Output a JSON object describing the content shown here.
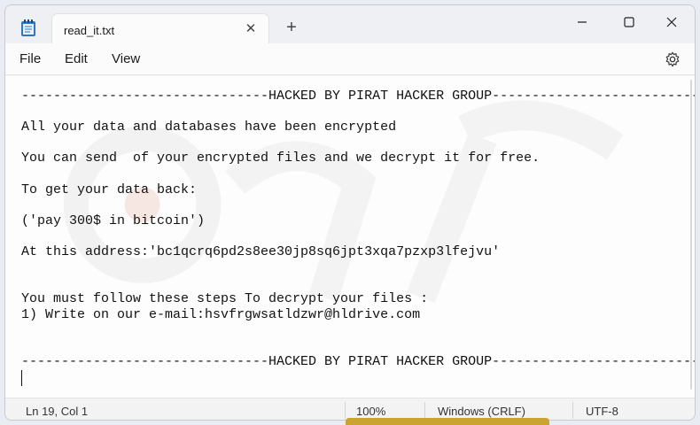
{
  "tab": {
    "title": "read_it.txt",
    "close_glyph": "✕",
    "new_tab_glyph": "+"
  },
  "menu": {
    "file": "File",
    "edit": "Edit",
    "view": "View"
  },
  "document": {
    "lines": [
      "-------------------------------HACKED BY PIRAT HACKER GROUP-------------------------------",
      "All your data and databases have been encrypted",
      "You can send  of your encrypted files and we decrypt it for free.",
      "To get your data back:",
      "('pay 300$ in bitcoin')",
      "At this address:'bc1qcrq6pd2s8ee30jp8sq6jpt3xqa7pzxp3lfejvu'",
      "You must follow these steps To decrypt your files :",
      "1) Write on our e-mail:hsvfrgwsatldzwr@hldrive.com",
      "-------------------------------HACKED BY PIRAT HACKER GROUP-------------------------------"
    ]
  },
  "status": {
    "position": "Ln 19, Col 1",
    "zoom": "100%",
    "line_ending": "Windows (CRLF)",
    "encoding": "UTF-8"
  },
  "icons": {
    "app": "notepad-icon",
    "settings": "gear-icon",
    "minimize": "minimize-icon",
    "maximize": "maximize-icon",
    "close": "close-icon"
  }
}
